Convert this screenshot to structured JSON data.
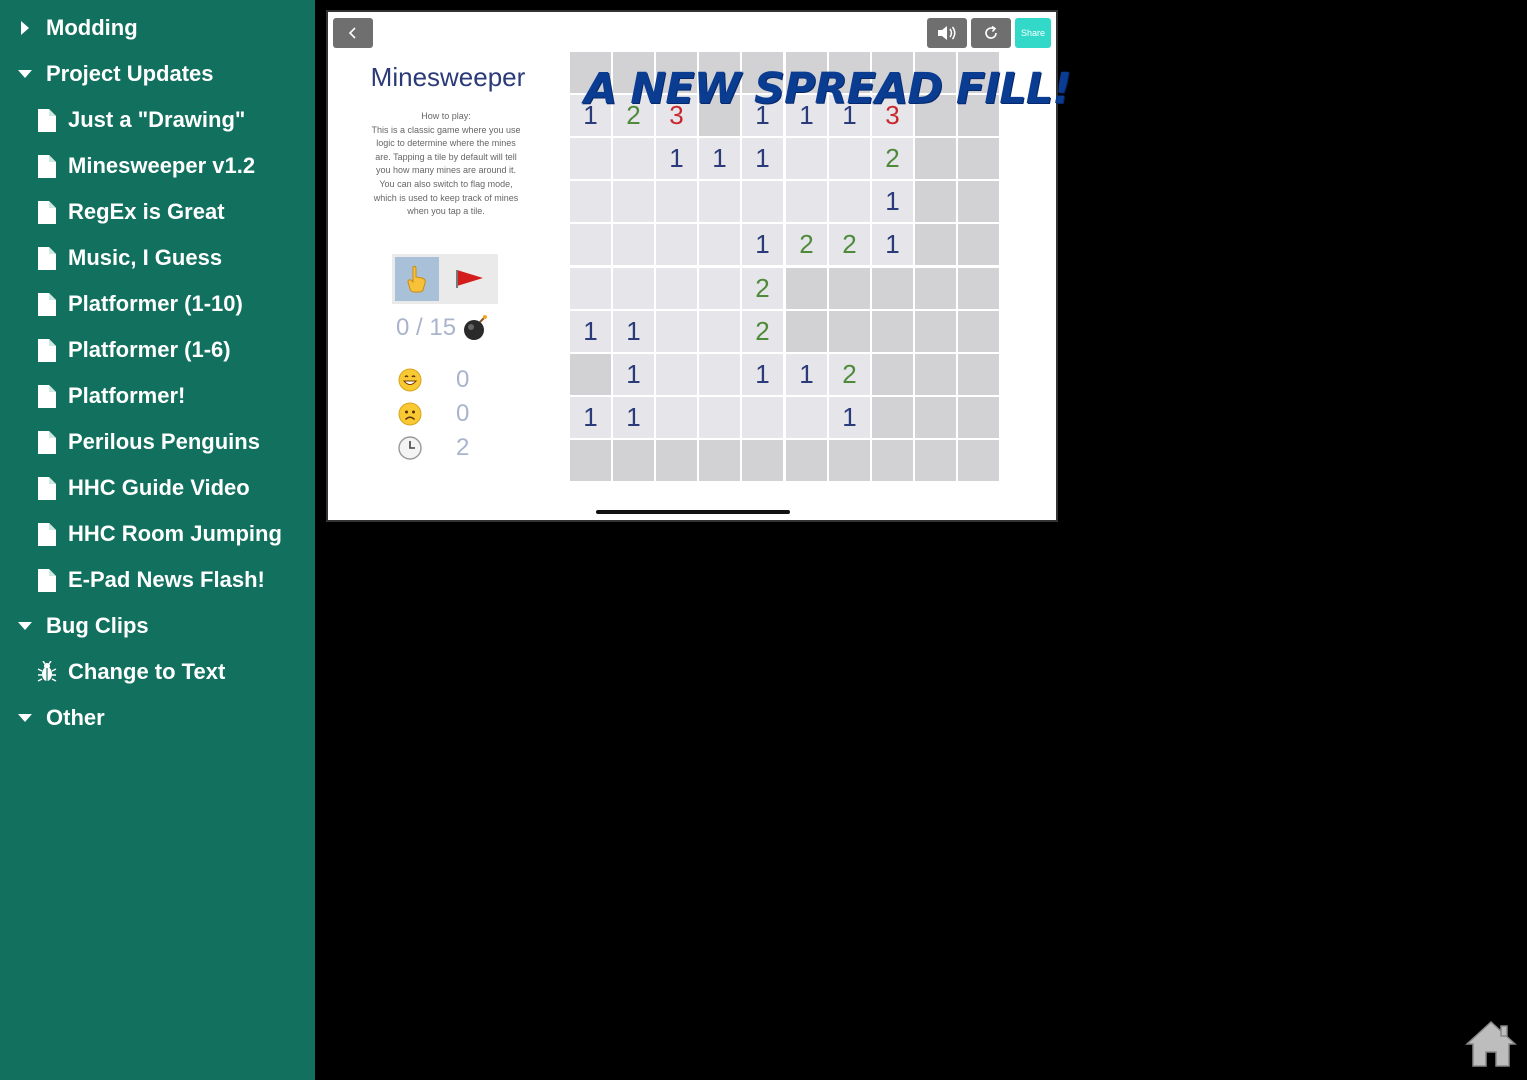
{
  "sidebar": {
    "items": [
      {
        "label": "Modding",
        "kind": "folder",
        "expanded": false
      },
      {
        "label": "Project Updates",
        "kind": "folder",
        "expanded": true
      },
      {
        "label": "Just a \"Drawing\"",
        "kind": "page"
      },
      {
        "label": "Minesweeper v1.2",
        "kind": "page"
      },
      {
        "label": "RegEx is Great",
        "kind": "page"
      },
      {
        "label": "Music, I Guess",
        "kind": "page"
      },
      {
        "label": "Platformer (1-10)",
        "kind": "page"
      },
      {
        "label": "Platformer (1-6)",
        "kind": "page"
      },
      {
        "label": "Platformer!",
        "kind": "page"
      },
      {
        "label": "Perilous Penguins",
        "kind": "page"
      },
      {
        "label": "HHC Guide Video",
        "kind": "page"
      },
      {
        "label": "HHC Room Jumping",
        "kind": "page"
      },
      {
        "label": "E-Pad News Flash!",
        "kind": "page"
      },
      {
        "label": "Bug Clips",
        "kind": "folder",
        "expanded": true
      },
      {
        "label": "Change to Text",
        "kind": "bug"
      },
      {
        "label": "Other",
        "kind": "folder",
        "expanded": true
      }
    ]
  },
  "game": {
    "title": "Minesweeper",
    "howto": "How to play:\nThis is a classic game where you use logic to determine where the mines are. Tapping a tile by default will tell you how many mines are around it. You can also switch to flag mode, which is used to keep track of mines when you tap a tile.",
    "share_label": "Share",
    "mine_counter": "0 / 15",
    "wins": "0",
    "losses": "0",
    "time": "2",
    "banner_text": "A NEW SPREAD FILL!",
    "icons": {
      "back": "chevron-left-icon",
      "sound": "speaker-icon",
      "refresh": "refresh-icon",
      "tap_mode": "pointing-hand-icon",
      "flag_mode": "red-flag-icon",
      "mine": "bomb-icon",
      "wins": "grinning-face-icon",
      "losses": "frowning-face-icon",
      "time": "clock-icon"
    },
    "colors": {
      "num1": "#2b3a78",
      "num2": "#4f8a3b",
      "num3": "#c8282d",
      "share": "#33d9c8",
      "sidebar": "#11705e"
    },
    "board": [
      [
        "h",
        "h",
        "h",
        "h",
        "h",
        "h",
        "h",
        "h",
        "h",
        "h"
      ],
      [
        "1",
        "2",
        "3",
        "h",
        "1",
        "1",
        "1",
        "3",
        "h",
        "h"
      ],
      [
        "",
        "",
        "1",
        "1",
        "1",
        "",
        "",
        "2",
        "h",
        "h"
      ],
      [
        "",
        "",
        "",
        "",
        "",
        "",
        "",
        "1",
        "h",
        "h"
      ],
      [
        "",
        "",
        "",
        "",
        "1",
        "2",
        "2",
        "1",
        "h",
        "h"
      ],
      [
        "",
        "",
        "",
        "",
        "2",
        "h",
        "h",
        "h",
        "h",
        "h"
      ],
      [
        "1",
        "1",
        "",
        "",
        "2",
        "h",
        "h",
        "h",
        "h",
        "h"
      ],
      [
        "h",
        "1",
        "",
        "",
        "1",
        "1",
        "2",
        "h",
        "h",
        "h"
      ],
      [
        "1",
        "1",
        "",
        "",
        "",
        "",
        "1",
        "h",
        "h",
        "h"
      ],
      [
        "h",
        "h",
        "h",
        "h",
        "h",
        "h",
        "h",
        "h",
        "h",
        "h"
      ]
    ]
  }
}
